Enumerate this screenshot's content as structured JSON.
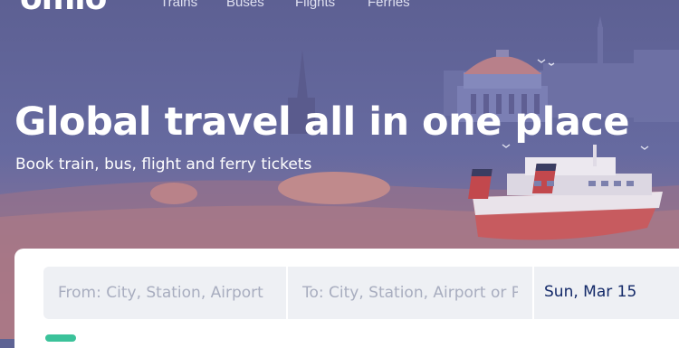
{
  "app": {
    "logo": "omio"
  },
  "nav": {
    "links": [
      "Trains",
      "Buses",
      "Flights",
      "Ferries"
    ]
  },
  "hero": {
    "headline": "Global travel all in one place",
    "subline": "Book train, bus, flight and ferry tickets"
  },
  "search": {
    "from_placeholder": "From: City, Station, Airport",
    "to_placeholder": "To: City, Station, Airport or Port",
    "date_value": "Sun, Mar 15"
  },
  "colors": {
    "hero_bg": "#5e6394",
    "text_dark": "#132968",
    "field_bg": "#eef0f4",
    "accent_green": "#3bc29a"
  }
}
